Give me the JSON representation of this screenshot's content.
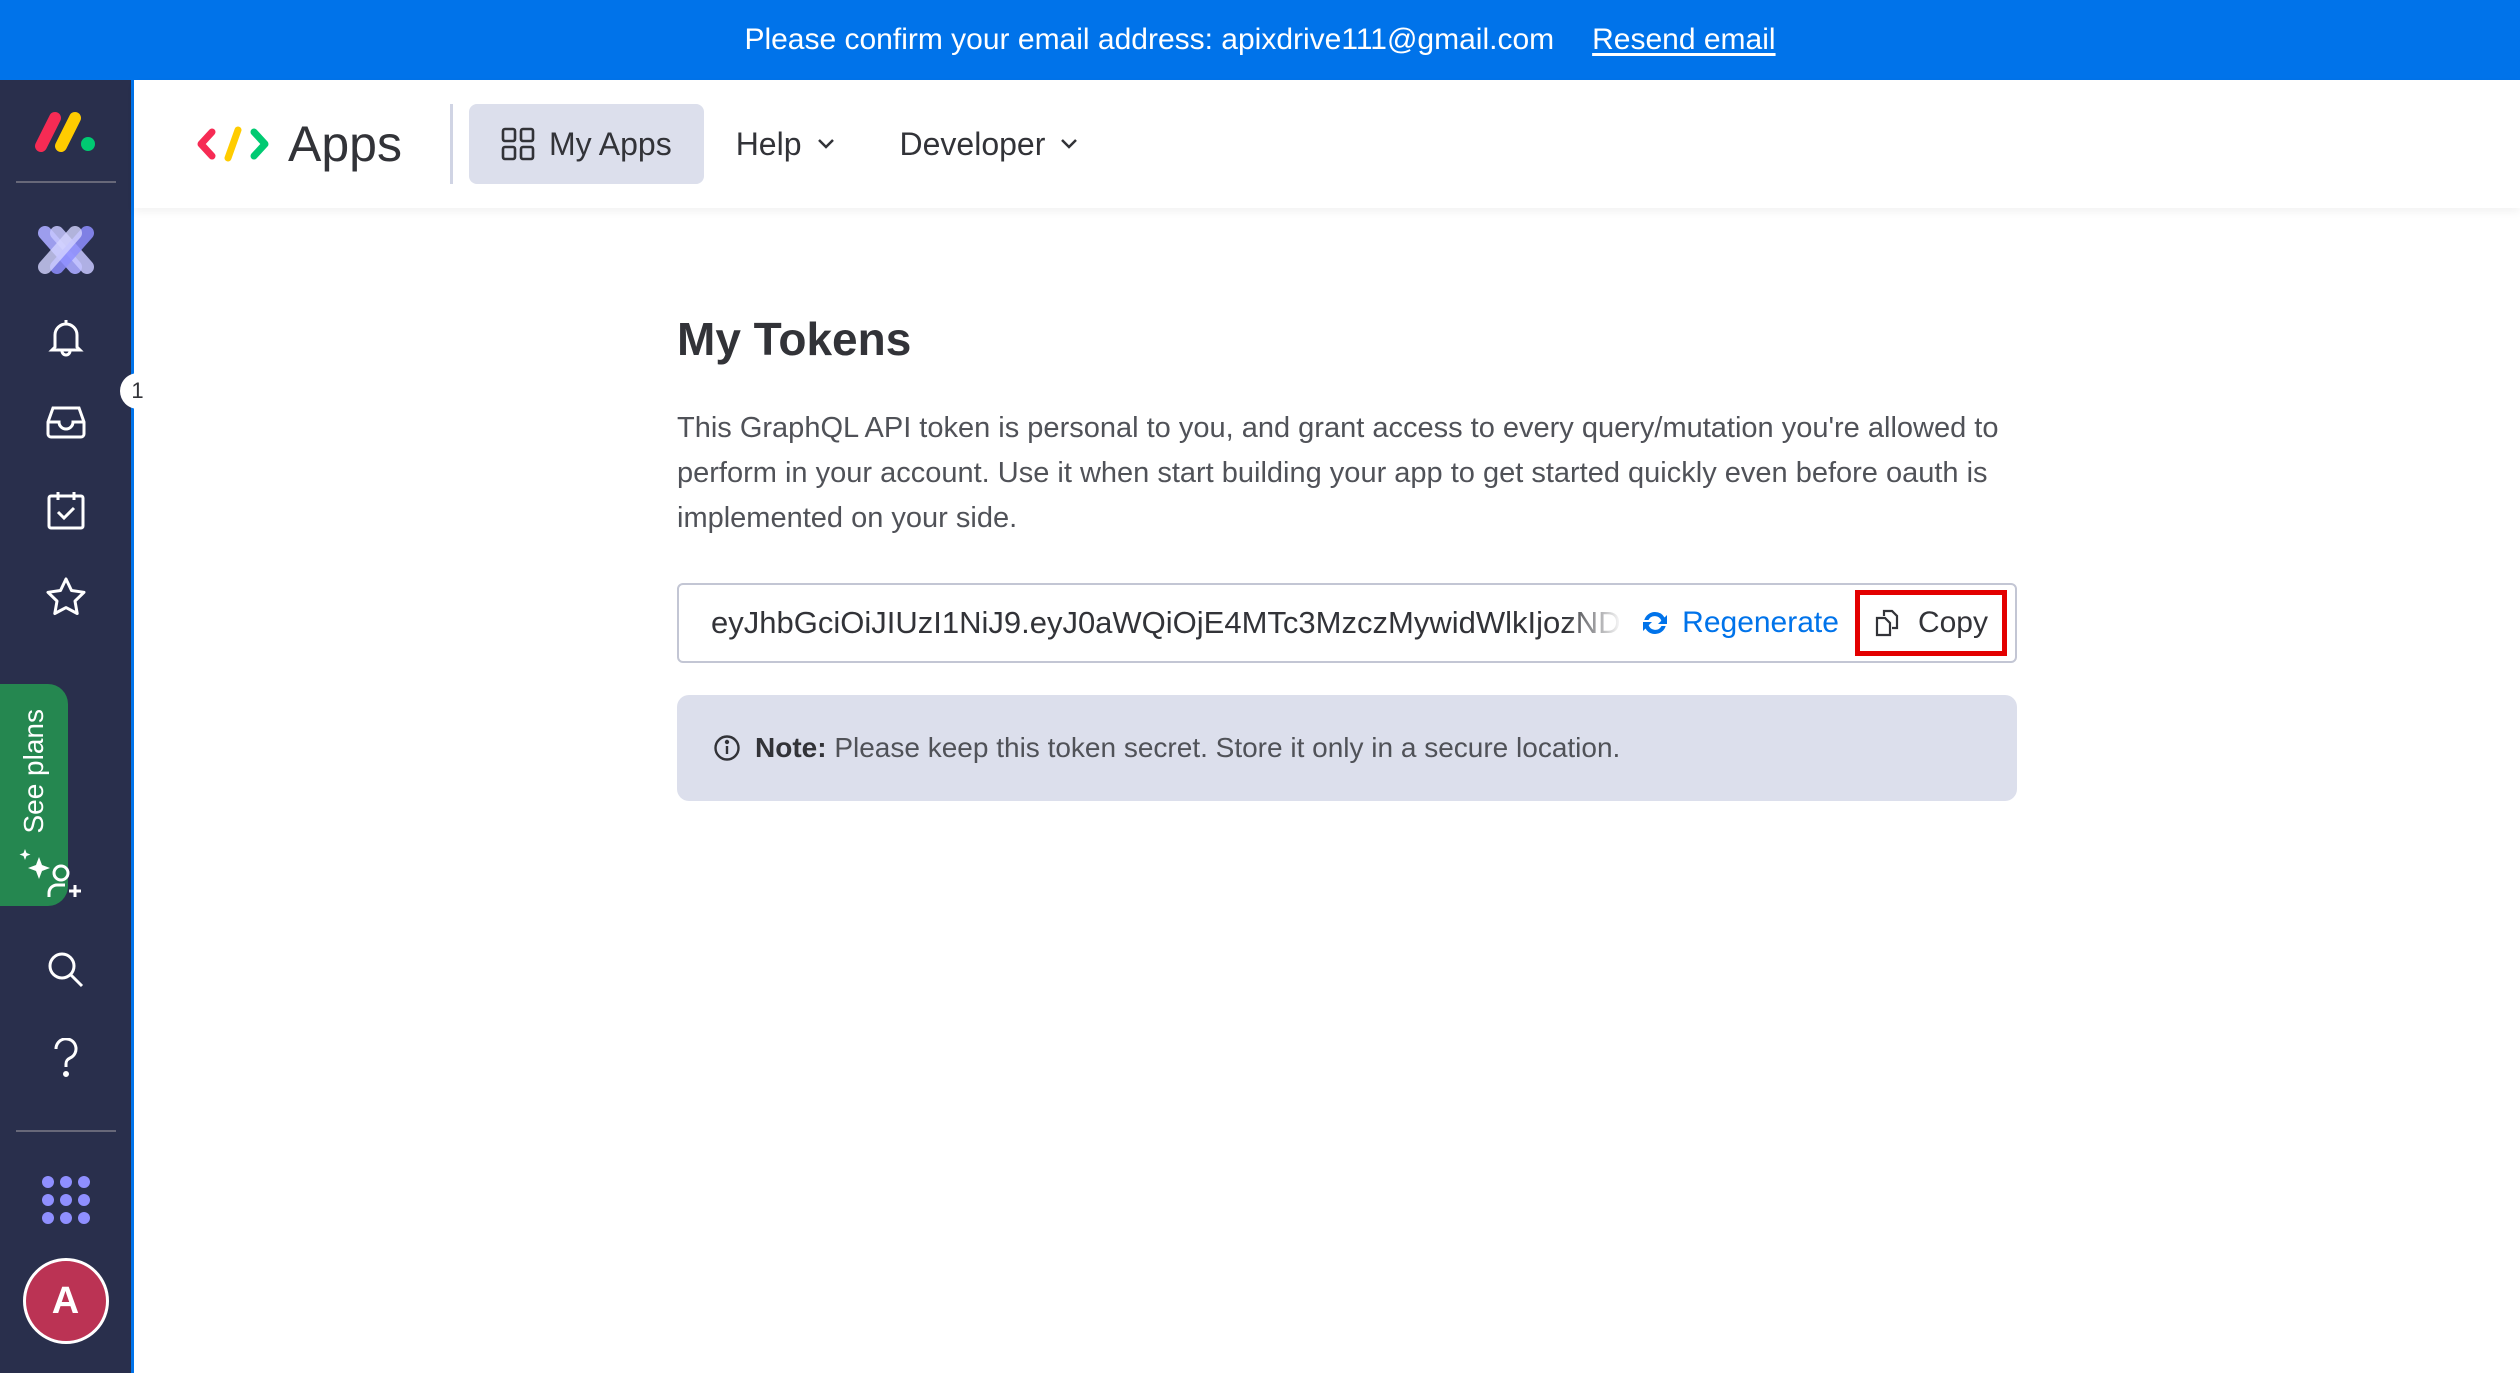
{
  "banner": {
    "message": "Please confirm your email address: apixdrive111@gmail.com",
    "resend_label": "Resend email",
    "color": "#0073ea"
  },
  "sidebar": {
    "items": [
      {
        "name": "monday-logo",
        "icon": "monday-logo-icon"
      },
      {
        "name": "workspace-switcher",
        "icon": "developer-x-icon"
      },
      {
        "name": "notifications",
        "icon": "bell-icon"
      },
      {
        "name": "inbox",
        "icon": "inbox-icon",
        "badge": "1"
      },
      {
        "name": "my-work",
        "icon": "calendar-check-icon"
      },
      {
        "name": "favorites",
        "icon": "star-icon"
      },
      {
        "name": "invite-members",
        "icon": "person-add-icon"
      },
      {
        "name": "search",
        "icon": "search-icon"
      },
      {
        "name": "help",
        "icon": "question-icon"
      },
      {
        "name": "apps-menu",
        "icon": "grid-dots-icon"
      }
    ],
    "see_plans_label": "See plans",
    "avatar_initial": "A",
    "avatar_color": "#bb3354",
    "see_plans_color": "#258750"
  },
  "header": {
    "title": "Apps",
    "nav": [
      {
        "label": "My Apps",
        "active": true
      },
      {
        "label": "Help",
        "dropdown": true
      },
      {
        "label": "Developer",
        "dropdown": true
      }
    ]
  },
  "main": {
    "title": "My Tokens",
    "description": "This GraphQL API token is personal to you, and grant access to every query/mutation you're allowed to perform in your account. Use it when start building your app to get started quickly even before oauth is implemented on your side.",
    "token_value": "eyJhbGciOiJIUzI1NiJ9.eyJ0aWQiOjE4MTc3MzczMywidWlkIjozND",
    "regenerate_label": "Regenerate",
    "copy_label": "Copy",
    "note_label": "Note:",
    "note_text": "Please keep this token secret. Store it only in a secure location.",
    "highlight_color": "#e30000"
  }
}
